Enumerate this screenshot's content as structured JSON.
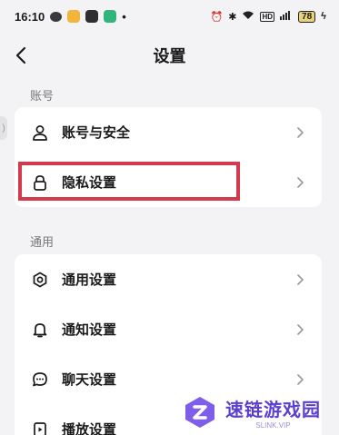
{
  "status_bar": {
    "time": "16:10",
    "dot": "•",
    "network": "HD",
    "battery": "78"
  },
  "nav": {
    "title": "设置",
    "back_icon": "chevron-left-icon"
  },
  "sections": [
    {
      "label": "账号",
      "items": [
        {
          "label": "账号与安全",
          "icon": "user-icon"
        },
        {
          "label": "隐私设置",
          "icon": "lock-icon"
        }
      ]
    },
    {
      "label": "通用",
      "items": [
        {
          "label": "通用设置",
          "icon": "gear-icon"
        },
        {
          "label": "通知设置",
          "icon": "bell-icon"
        },
        {
          "label": "聊天设置",
          "icon": "chat-icon"
        },
        {
          "label": "播放设置",
          "icon": "play-settings-icon"
        }
      ]
    }
  ],
  "highlight_color": "#d33a4e",
  "watermark": {
    "title": "速链游戏园",
    "subtitle": "SLINK.VIP"
  }
}
